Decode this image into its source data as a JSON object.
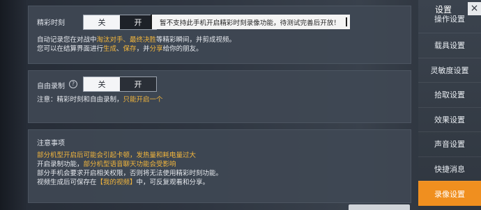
{
  "highlight_section": {
    "label": "精彩时刻",
    "toggle_off": "关",
    "toggle_on": "开",
    "tooltip": "暂不支持此手机开启精彩时刻录像功能，待测试完善后开放！",
    "desc1_a": "自动记录您在对战中",
    "desc1_b": "淘汰对手、最终决胜",
    "desc1_c": "等精彩瞬间，并剪成视频。",
    "desc2_a": "您可以在结算界面进行",
    "desc2_b": "生成",
    "desc2_c": "、",
    "desc2_d": "保存",
    "desc2_e": "，并",
    "desc2_f": "分享",
    "desc2_g": "给你的朋友。"
  },
  "free_record_section": {
    "label": "自由录制",
    "toggle_off": "关",
    "toggle_on": "开",
    "note_a": "注意：精彩时刻和自由录制，",
    "note_b": "只能开启一个"
  },
  "notice_section": {
    "title": "注意事项",
    "line1": "部分机型开启后可能会引起卡顿，发热量和耗电量过大",
    "line2_a": "开启录制功能，",
    "line2_b": "部分机型语音聊天功能会受影响",
    "line3": "部分手机会要求开启相关权限，否则将无法使用精彩时刻功能。",
    "line4_a": "视频生成后可保存在",
    "line4_b": "【我的视频】",
    "line4_c": "中，可反复观看和分享。"
  },
  "sidebar": {
    "title": "设置",
    "close": "×",
    "items": [
      {
        "label": "操作设置"
      },
      {
        "label": "载具设置"
      },
      {
        "label": "灵敏度设置"
      },
      {
        "label": "拾取设置"
      },
      {
        "label": "效果设置"
      },
      {
        "label": "声音设置"
      },
      {
        "label": "快捷消息"
      },
      {
        "label": "录像设置"
      }
    ]
  },
  "colors": {
    "accent": "#f08f1f",
    "highlight_text": "#f3b63c"
  }
}
